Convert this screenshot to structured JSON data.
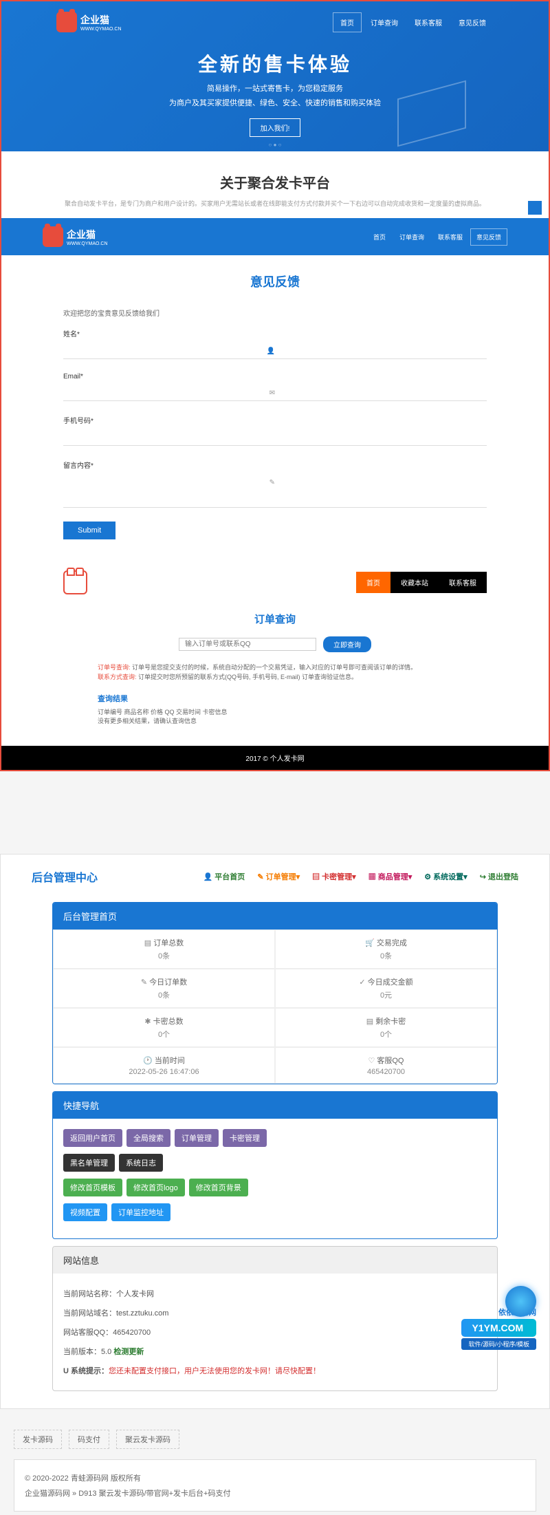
{
  "hero": {
    "logo_text": "企业猫",
    "logo_sub": "WWW.QYMAO.CN",
    "nav": [
      "首页",
      "订单查询",
      "联系客服",
      "意见反馈"
    ],
    "title": "全新的售卡体验",
    "sub1": "简易操作，一站式寄售卡，为您稳定服务",
    "sub2": "为商户及其买家提供便捷、绿色、安全、快速的销售和购买体验",
    "btn": "加入我们!"
  },
  "about": {
    "title": "关于聚合发卡平台",
    "desc": "聚合自动发卡平台，是专门为商户和用户设计的。买家用户无需站长或者在线即能支付方式付款并买个一下右边可以自动完成收货和一定度量的虚拟商品。"
  },
  "feedback": {
    "title": "意见反馈",
    "desc": "欢迎把您的宝贵意见反馈给我们",
    "labels": {
      "name": "姓名*",
      "email": "Email*",
      "phone": "手机号码*",
      "content": "留言内容*"
    },
    "submit": "Submit"
  },
  "order": {
    "nav": [
      "首页",
      "收藏本站",
      "联系客服"
    ],
    "title": "订单查询",
    "placeholder": "输入订单号或联系QQ",
    "search_btn": "立即查询",
    "info1_label": "订单号查询:",
    "info1": "订单号是您提交支付的时候，系统自动分配的一个交易凭证，输入对应的订单号即可查阅该订单的详情。",
    "info2_label": "联系方式查询:",
    "info2": "订单提交时您所预留的联系方式(QQ号码, 手机号码, E-mail) 订单查询验证信息。",
    "result_title": "查询结果",
    "result_head": "订单编号 商品名称 价格 QQ 交易时间 卡密信息",
    "result_empty": "没有更多相关结果，请确认查询信息",
    "footer": "2017 © 个人发卡网"
  },
  "admin": {
    "title": "后台管理中心",
    "nav": [
      {
        "icon": "👤",
        "label": "平台首页",
        "color": "c-green"
      },
      {
        "icon": "✎",
        "label": "订单管理",
        "color": "c-orange",
        "dropdown": true
      },
      {
        "icon": "▤",
        "label": "卡密管理",
        "color": "c-red",
        "dropdown": true
      },
      {
        "icon": "▦",
        "label": "商品管理",
        "color": "c-pink",
        "dropdown": true
      },
      {
        "icon": "⚙",
        "label": "系统设置",
        "color": "c-darkgreen",
        "dropdown": true
      },
      {
        "icon": "↪",
        "label": "退出登陆",
        "color": "c-green"
      }
    ],
    "panel1_title": "后台管理首页",
    "stats": [
      {
        "icon": "▤",
        "label": "订单总数",
        "value": "0条"
      },
      {
        "icon": "🛒",
        "label": "交易完成",
        "value": "0条"
      },
      {
        "icon": "✎",
        "label": "今日订单数",
        "value": "0条"
      },
      {
        "icon": "✓",
        "label": "今日成交金额",
        "value": "0元"
      },
      {
        "icon": "✱",
        "label": "卡密总数",
        "value": "0个"
      },
      {
        "icon": "▤",
        "label": "剩余卡密",
        "value": "0个"
      },
      {
        "icon": "🕐",
        "label": "当前时间",
        "value": "2022-05-26 16:47:06"
      },
      {
        "icon": "♡",
        "label": "客服QQ",
        "value": "465420700"
      }
    ],
    "panel2_title": "快捷导航",
    "tags1": [
      "返回用户首页",
      "全局搜索",
      "订单管理",
      "卡密管理"
    ],
    "tags2": [
      "黑名单管理",
      "系统日志"
    ],
    "tags3": [
      "修改首页模板",
      "修改首页logo",
      "修改首页背景"
    ],
    "tags4": [
      "视频配置",
      "订单监控地址"
    ],
    "panel3_title": "网站信息",
    "info": [
      {
        "label": "当前网站名称：",
        "value": "个人发卡网"
      },
      {
        "label": "当前网站域名：",
        "value": "test.zztuku.com"
      },
      {
        "label": "网站客服QQ：",
        "value": "465420700"
      }
    ],
    "version_label": "当前版本：5.0  ",
    "version_check": "检测更新",
    "warning_icon": "U",
    "warning_label": "系统提示：",
    "warning_text": "您还未配置支付接口，用户无法使用您的发卡网！请尽快配置！"
  },
  "footer": {
    "tags": [
      "发卡源码",
      "码支付",
      "聚云发卡源码"
    ],
    "copy": "© 2020-2022 青蛙源码网 版权所有",
    "breadcrumb": "企业猫源码网 » D913 聚云发卡源码/带官网+发卡后台+码支付"
  },
  "watermark": {
    "text": "Y1YM.COM",
    "sub": "软件/源码/小程序/模板",
    "brand": "依依源码网"
  }
}
